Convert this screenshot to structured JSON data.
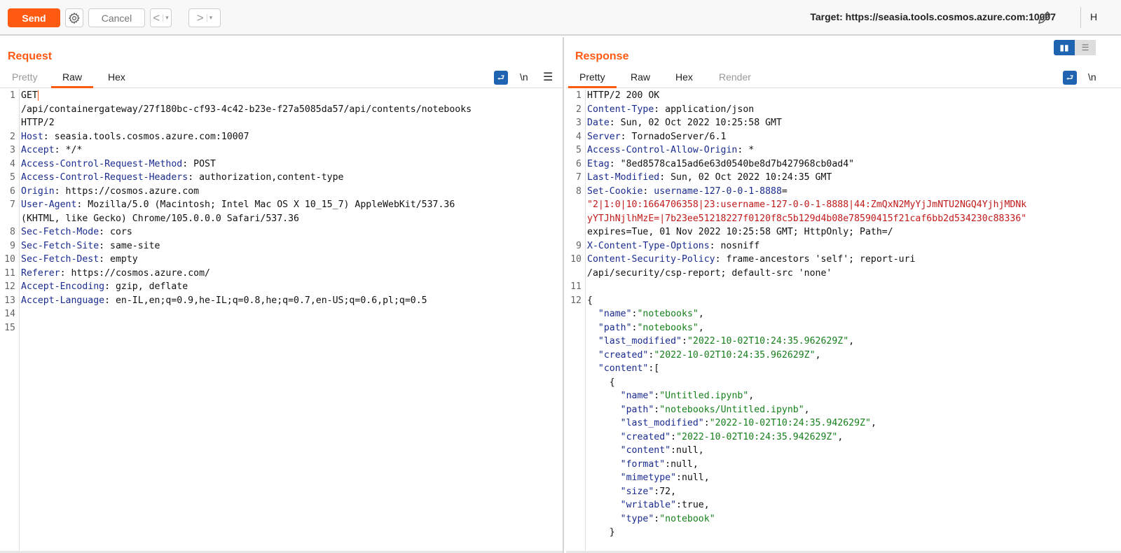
{
  "toolbar": {
    "send": "Send",
    "cancel": "Cancel",
    "back": "<",
    "forward": ">",
    "dropdown": "▾",
    "target": "Target: https://seasia.tools.cosmos.azure.com:10007",
    "cut": "H"
  },
  "request": {
    "title": "Request",
    "tabs": [
      "Pretty",
      "Raw",
      "Hex"
    ],
    "active_tab": "Raw",
    "newline": "\\n",
    "menu": "☰",
    "lines": [
      {
        "n": "1",
        "seg": [
          [
            "",
            "GET"
          ]
        ]
      },
      {
        "n": "",
        "seg": [
          [
            "",
            "/api/containergateway/27f180bc-cf93-4c42-b23e-f27a5085da57/api/contents/notebooks"
          ]
        ]
      },
      {
        "n": "",
        "seg": [
          [
            "",
            "HTTP/2"
          ]
        ]
      },
      {
        "n": "2",
        "seg": [
          [
            "k",
            "Host"
          ],
          [
            "",
            ": seasia.tools.cosmos.azure.com:10007"
          ]
        ]
      },
      {
        "n": "3",
        "seg": [
          [
            "k",
            "Accept"
          ],
          [
            "",
            ": */*"
          ]
        ]
      },
      {
        "n": "4",
        "seg": [
          [
            "k",
            "Access-Control-Request-Method"
          ],
          [
            "",
            ": POST"
          ]
        ]
      },
      {
        "n": "5",
        "seg": [
          [
            "k",
            "Access-Control-Request-Headers"
          ],
          [
            "",
            ": authorization,content-type"
          ]
        ]
      },
      {
        "n": "6",
        "seg": [
          [
            "k",
            "Origin"
          ],
          [
            "",
            ": https://cosmos.azure.com"
          ]
        ]
      },
      {
        "n": "7",
        "seg": [
          [
            "k",
            "User-Agent"
          ],
          [
            "",
            ": Mozilla/5.0 (Macintosh; Intel Mac OS X 10_15_7) AppleWebKit/537.36"
          ]
        ]
      },
      {
        "n": "",
        "seg": [
          [
            "",
            "(KHTML, like Gecko) Chrome/105.0.0.0 Safari/537.36"
          ]
        ]
      },
      {
        "n": "8",
        "seg": [
          [
            "k",
            "Sec-Fetch-Mode"
          ],
          [
            "",
            ": cors"
          ]
        ]
      },
      {
        "n": "9",
        "seg": [
          [
            "k",
            "Sec-Fetch-Site"
          ],
          [
            "",
            ": same-site"
          ]
        ]
      },
      {
        "n": "10",
        "seg": [
          [
            "k",
            "Sec-Fetch-Dest"
          ],
          [
            "",
            ": empty"
          ]
        ]
      },
      {
        "n": "11",
        "seg": [
          [
            "k",
            "Referer"
          ],
          [
            "",
            ": https://cosmos.azure.com/"
          ]
        ]
      },
      {
        "n": "12",
        "seg": [
          [
            "k",
            "Accept-Encoding"
          ],
          [
            "",
            ": gzip, deflate"
          ]
        ]
      },
      {
        "n": "13",
        "seg": [
          [
            "k",
            "Accept-Language"
          ],
          [
            "",
            ": en-IL,en;q=0.9,he-IL;q=0.8,he;q=0.7,en-US;q=0.6,pl;q=0.5"
          ]
        ]
      },
      {
        "n": "14",
        "seg": []
      },
      {
        "n": "15",
        "seg": []
      }
    ]
  },
  "response": {
    "title": "Response",
    "tabs": [
      "Pretty",
      "Raw",
      "Hex",
      "Render"
    ],
    "active_tab": "Pretty",
    "newline": "\\n",
    "lines": [
      {
        "n": "1",
        "seg": [
          [
            "",
            "HTTP/2 200 OK"
          ]
        ]
      },
      {
        "n": "2",
        "seg": [
          [
            "k",
            "Content-Type"
          ],
          [
            "",
            ": application/json"
          ]
        ]
      },
      {
        "n": "3",
        "seg": [
          [
            "k",
            "Date"
          ],
          [
            "",
            ": Sun, 02 Oct 2022 10:25:58 GMT"
          ]
        ]
      },
      {
        "n": "4",
        "seg": [
          [
            "k",
            "Server"
          ],
          [
            "",
            ": TornadoServer/6.1"
          ]
        ]
      },
      {
        "n": "5",
        "seg": [
          [
            "k",
            "Access-Control-Allow-Origin"
          ],
          [
            "",
            ": *"
          ]
        ]
      },
      {
        "n": "6",
        "seg": [
          [
            "k",
            "Etag"
          ],
          [
            "",
            ": \"8ed8578ca15ad6e63d0540be8d7b427968cb0ad4\""
          ]
        ]
      },
      {
        "n": "7",
        "seg": [
          [
            "k",
            "Last-Modified"
          ],
          [
            "",
            ": Sun, 02 Oct 2022 10:24:35 GMT"
          ]
        ]
      },
      {
        "n": "8",
        "seg": [
          [
            "k",
            "Set-Cookie"
          ],
          [
            "",
            ": "
          ],
          [
            "b",
            "username-127-0-0-1-8888"
          ],
          [
            "",
            "="
          ]
        ]
      },
      {
        "n": "",
        "seg": [
          [
            "r",
            "\"2|1:0|10:1664706358|23:username-127-0-0-1-8888|44:ZmQxN2MyYjJmNTU2NGQ4YjhjMDNk"
          ]
        ]
      },
      {
        "n": "",
        "seg": [
          [
            "r",
            "yYTJhNjlhMzE=|7b23ee51218227f0120f8c5b129d4b08e78590415f21caf6bb2d534230c88336\""
          ]
        ]
      },
      {
        "n": "",
        "seg": [
          [
            "",
            "expires=Tue, 01 Nov 2022 10:25:58 GMT; HttpOnly; Path=/"
          ]
        ]
      },
      {
        "n": "9",
        "seg": [
          [
            "k",
            "X-Content-Type-Options"
          ],
          [
            "",
            ": nosniff"
          ]
        ]
      },
      {
        "n": "10",
        "seg": [
          [
            "k",
            "Content-Security-Policy"
          ],
          [
            "",
            ": frame-ancestors 'self'; report-uri"
          ]
        ]
      },
      {
        "n": "",
        "seg": [
          [
            "",
            "/api/security/csp-report; default-src 'none'"
          ]
        ]
      },
      {
        "n": "11",
        "seg": []
      },
      {
        "n": "12",
        "seg": [
          [
            "",
            "{"
          ]
        ]
      },
      {
        "n": "",
        "seg": [
          [
            "",
            "  "
          ],
          [
            "k",
            "\"name\""
          ],
          [
            "",
            ":"
          ],
          [
            "s",
            "\"notebooks\""
          ],
          [
            "",
            ","
          ]
        ]
      },
      {
        "n": "",
        "seg": [
          [
            "",
            "  "
          ],
          [
            "k",
            "\"path\""
          ],
          [
            "",
            ":"
          ],
          [
            "s",
            "\"notebooks\""
          ],
          [
            "",
            ","
          ]
        ]
      },
      {
        "n": "",
        "seg": [
          [
            "",
            "  "
          ],
          [
            "k",
            "\"last_modified\""
          ],
          [
            "",
            ":"
          ],
          [
            "s",
            "\"2022-10-02T10:24:35.962629Z\""
          ],
          [
            "",
            ","
          ]
        ]
      },
      {
        "n": "",
        "seg": [
          [
            "",
            "  "
          ],
          [
            "k",
            "\"created\""
          ],
          [
            "",
            ":"
          ],
          [
            "s",
            "\"2022-10-02T10:24:35.962629Z\""
          ],
          [
            "",
            ","
          ]
        ]
      },
      {
        "n": "",
        "seg": [
          [
            "",
            "  "
          ],
          [
            "k",
            "\"content\""
          ],
          [
            "",
            ":["
          ]
        ]
      },
      {
        "n": "",
        "seg": [
          [
            "",
            "    {"
          ]
        ]
      },
      {
        "n": "",
        "seg": [
          [
            "",
            "      "
          ],
          [
            "k",
            "\"name\""
          ],
          [
            "",
            ":"
          ],
          [
            "s",
            "\"Untitled.ipynb\""
          ],
          [
            "",
            ","
          ]
        ]
      },
      {
        "n": "",
        "seg": [
          [
            "",
            "      "
          ],
          [
            "k",
            "\"path\""
          ],
          [
            "",
            ":"
          ],
          [
            "s",
            "\"notebooks/Untitled.ipynb\""
          ],
          [
            "",
            ","
          ]
        ]
      },
      {
        "n": "",
        "seg": [
          [
            "",
            "      "
          ],
          [
            "k",
            "\"last_modified\""
          ],
          [
            "",
            ":"
          ],
          [
            "s",
            "\"2022-10-02T10:24:35.942629Z\""
          ],
          [
            "",
            ","
          ]
        ]
      },
      {
        "n": "",
        "seg": [
          [
            "",
            "      "
          ],
          [
            "k",
            "\"created\""
          ],
          [
            "",
            ":"
          ],
          [
            "s",
            "\"2022-10-02T10:24:35.942629Z\""
          ],
          [
            "",
            ","
          ]
        ]
      },
      {
        "n": "",
        "seg": [
          [
            "",
            "      "
          ],
          [
            "k",
            "\"content\""
          ],
          [
            "",
            ":null,"
          ]
        ]
      },
      {
        "n": "",
        "seg": [
          [
            "",
            "      "
          ],
          [
            "k",
            "\"format\""
          ],
          [
            "",
            ":null,"
          ]
        ]
      },
      {
        "n": "",
        "seg": [
          [
            "",
            "      "
          ],
          [
            "k",
            "\"mimetype\""
          ],
          [
            "",
            ":null,"
          ]
        ]
      },
      {
        "n": "",
        "seg": [
          [
            "",
            "      "
          ],
          [
            "k",
            "\"size\""
          ],
          [
            "",
            ":72,"
          ]
        ]
      },
      {
        "n": "",
        "seg": [
          [
            "",
            "      "
          ],
          [
            "k",
            "\"writable\""
          ],
          [
            "",
            ":true,"
          ]
        ]
      },
      {
        "n": "",
        "seg": [
          [
            "",
            "      "
          ],
          [
            "k",
            "\"type\""
          ],
          [
            "",
            ":"
          ],
          [
            "s",
            "\"notebook\""
          ]
        ]
      },
      {
        "n": "",
        "seg": [
          [
            "",
            "    }"
          ]
        ]
      }
    ]
  }
}
